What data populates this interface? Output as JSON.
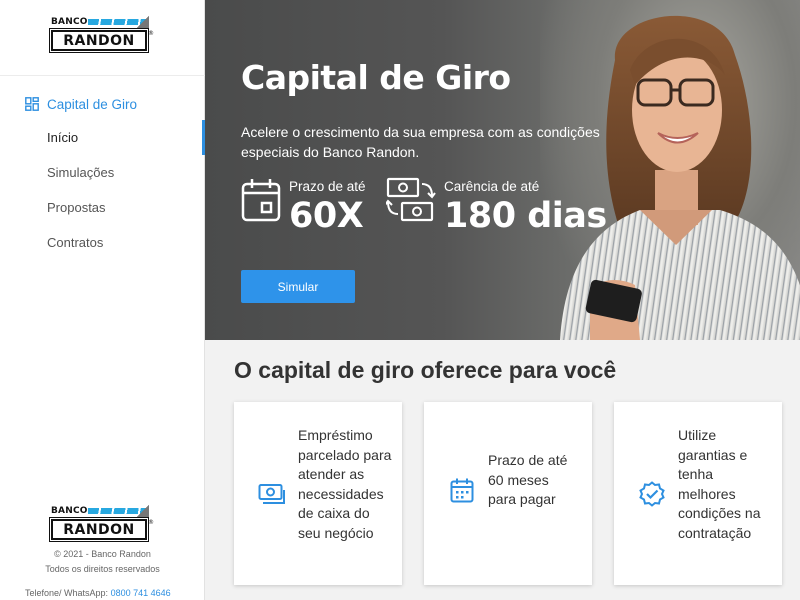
{
  "brand": {
    "top": "BANCO",
    "name": "RANDON",
    "reg": "®"
  },
  "sidebar": {
    "section_label": "Capital de Giro",
    "items": [
      {
        "label": "Início"
      },
      {
        "label": "Simulações"
      },
      {
        "label": "Propostas"
      },
      {
        "label": "Contratos"
      }
    ],
    "footer": {
      "copyright": "© 2021 - Banco Randon",
      "rights": "Todos os direitos reservados",
      "contact_label": "Telefone/ WhatsApp:",
      "contact_number": "0800 741 4646"
    }
  },
  "hero": {
    "title": "Capital de Giro",
    "description": "Acelere o crescimento da sua empresa com as condições especiais do Banco Randon.",
    "stats": [
      {
        "label": "Prazo de até",
        "value": "60X",
        "icon": "calendar-icon"
      },
      {
        "label": "Carência de até",
        "value": "180 dias",
        "icon": "money-exchange-icon"
      }
    ],
    "cta": "Simular"
  },
  "benefits": {
    "title": "O capital de giro oferece para você",
    "cards": [
      {
        "text": "Empréstimo parcelado para atender as necessidades de caixa do seu negócio",
        "icon": "money-bill-icon"
      },
      {
        "text": "Prazo de até 60 meses para pagar",
        "icon": "calendar-icon"
      },
      {
        "text": "Utilize garantias e tenha melhores condições na contratação",
        "icon": "verified-badge-icon"
      }
    ]
  },
  "colors": {
    "accent": "#2e93ea",
    "link": "#2d8fe0",
    "text": "#333333"
  }
}
